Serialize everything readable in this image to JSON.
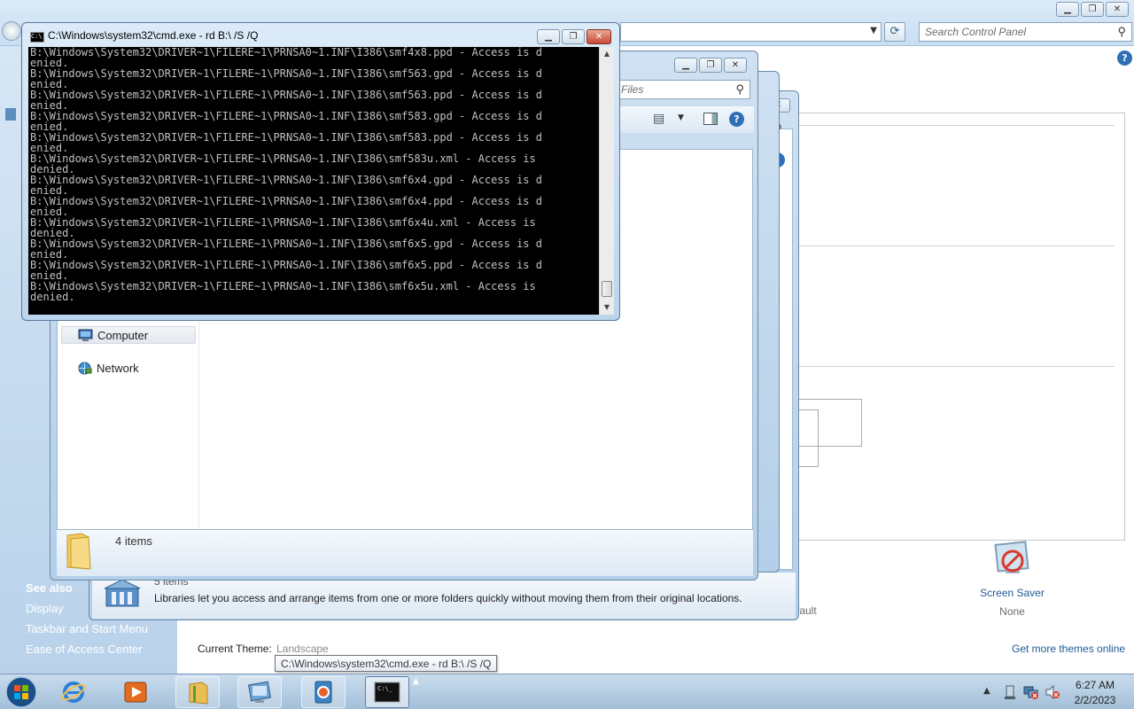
{
  "control_panel": {
    "search_placeholder": "Search Control Panel",
    "see_also_heading": "See also",
    "see_also_links": [
      "Display",
      "Taskbar and Start Menu",
      "Ease of Access Center"
    ],
    "default_fragment": "fault",
    "screen_saver_label": "Screen Saver",
    "screen_saver_value": "None",
    "current_theme_label": "Current Theme:",
    "current_theme_value": "Landscape",
    "more_themes_link": "Get more themes online"
  },
  "libraries_window": {
    "status_count": "5 items",
    "status_description": "Libraries let you access and arrange items from one or more folders quickly without moving them from their original locations."
  },
  "explorer_window": {
    "search_placeholder": "Files",
    "nav_items": [
      "Computer",
      "Network"
    ],
    "status_count": "4 items"
  },
  "cmd_window": {
    "title": "C:\\Windows\\system32\\cmd.exe - rd  B:\\ /S /Q",
    "output_lines": [
      "B:\\Windows\\System32\\DRIVER~1\\FILERE~1\\PRNSA0~1.INF\\I386\\smf4x8.ppd - Access is d",
      "enied.",
      "B:\\Windows\\System32\\DRIVER~1\\FILERE~1\\PRNSA0~1.INF\\I386\\smf563.gpd - Access is d",
      "enied.",
      "B:\\Windows\\System32\\DRIVER~1\\FILERE~1\\PRNSA0~1.INF\\I386\\smf563.ppd - Access is d",
      "enied.",
      "B:\\Windows\\System32\\DRIVER~1\\FILERE~1\\PRNSA0~1.INF\\I386\\smf583.gpd - Access is d",
      "enied.",
      "B:\\Windows\\System32\\DRIVER~1\\FILERE~1\\PRNSA0~1.INF\\I386\\smf583.ppd - Access is d",
      "enied.",
      "B:\\Windows\\System32\\DRIVER~1\\FILERE~1\\PRNSA0~1.INF\\I386\\smf583u.xml - Access is",
      "denied.",
      "B:\\Windows\\System32\\DRIVER~1\\FILERE~1\\PRNSA0~1.INF\\I386\\smf6x4.gpd - Access is d",
      "enied.",
      "B:\\Windows\\System32\\DRIVER~1\\FILERE~1\\PRNSA0~1.INF\\I386\\smf6x4.ppd - Access is d",
      "enied.",
      "B:\\Windows\\System32\\DRIVER~1\\FILERE~1\\PRNSA0~1.INF\\I386\\smf6x4u.xml - Access is",
      "denied.",
      "B:\\Windows\\System32\\DRIVER~1\\FILERE~1\\PRNSA0~1.INF\\I386\\smf6x5.gpd - Access is d",
      "enied.",
      "B:\\Windows\\System32\\DRIVER~1\\FILERE~1\\PRNSA0~1.INF\\I386\\smf6x5.ppd - Access is d",
      "enied.",
      "B:\\Windows\\System32\\DRIVER~1\\FILERE~1\\PRNSA0~1.INF\\I386\\smf6x5u.xml - Access is",
      "denied."
    ]
  },
  "taskbar": {
    "pinned_apps": [
      "start-orb",
      "internet-explorer",
      "media-player",
      "windows-explorer",
      "control-panel",
      "media-center",
      "command-prompt"
    ],
    "tooltip": "C:\\Windows\\system32\\cmd.exe - rd  B:\\ /S /Q",
    "clock_time": "6:27 AM",
    "clock_date": "2/2/2023"
  },
  "icons": {
    "search": "search-icon",
    "help": "help-icon",
    "folder": "folder-icon",
    "computer": "computer-icon",
    "network": "network-icon",
    "library": "library-icon",
    "screen_saver": "screen-saver-icon"
  },
  "colors": {
    "window_frame": "#bcd4ec",
    "console_background": "#000000",
    "console_text": "#c0c0c0",
    "link_blue": "#1e5a96",
    "close_red": "#c74a34",
    "left_pane_gradient": "#b9d2ea"
  }
}
